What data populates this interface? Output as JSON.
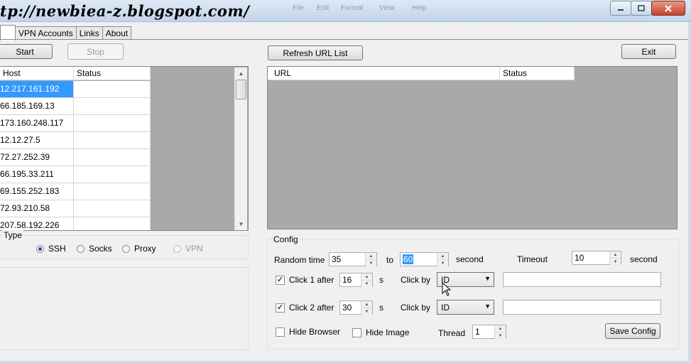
{
  "watermark": "tp://newbiea-z.blogspot.com/",
  "ghost_menu": [
    "File",
    "Edit",
    "Format",
    "View",
    "Help"
  ],
  "tabs": [
    "",
    "VPN Accounts",
    "Links",
    "About"
  ],
  "buttons": {
    "start": "Start",
    "stop": "Stop",
    "refresh": "Refresh URL List",
    "exit": "Exit",
    "save_config": "Save Config"
  },
  "host_grid": {
    "columns": [
      "Host",
      "Status"
    ],
    "rows": [
      "12.217.161.192",
      "66.185.169.13",
      "173.160.248.117",
      "12.12.27.5",
      "72.27.252.39",
      "66.195.33.211",
      "69.155.252.183",
      "72.93.210.58",
      "207.58.192.226"
    ]
  },
  "url_grid": {
    "columns": [
      "URL",
      "Status"
    ]
  },
  "type_group": {
    "label": "Type",
    "options": [
      "SSH",
      "Socks",
      "Proxy",
      "VPN"
    ],
    "selected": "SSH",
    "disabled": [
      "VPN"
    ]
  },
  "config": {
    "label": "Config",
    "random_time_label": "Random time",
    "random_from": "35",
    "to_label": "to",
    "random_to": "60",
    "second_label": "second",
    "timeout_label": "Timeout",
    "timeout": "10",
    "timeout_unit": "second",
    "click1_label": "Click 1 after",
    "click1_value": "16",
    "click2_label": "Click 2 after",
    "click2_value": "30",
    "s_label": "s",
    "clickby_label": "Click by",
    "clickby1": "ID",
    "clickby2": "ID",
    "hide_browser": "Hide Browser",
    "hide_image": "Hide Image",
    "thread_label": "Thread",
    "thread": "1"
  },
  "colors": {
    "selection": "#3399ff",
    "grid_bg": "#a9a9a9",
    "close_button": "#c5412b"
  }
}
